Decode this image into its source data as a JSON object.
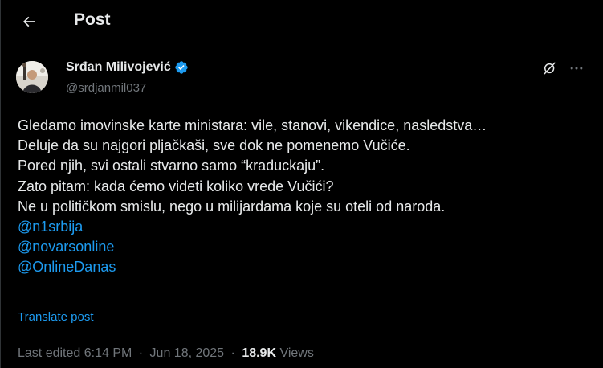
{
  "header": {
    "title": "Post",
    "back_icon": "arrow-left-icon"
  },
  "author": {
    "name": "Srđan Milivojević",
    "handle": "@srdjanmil037",
    "verified_color": "#1d9bf0",
    "verified_icon": "verified-badge-icon"
  },
  "actions": {
    "grok_icon": "grok-icon",
    "more_icon": "more-options-icon"
  },
  "tweet": {
    "lines": [
      "Gledamo imovinske karte ministara: vile, stanovi, vikendice, nasledstva…",
      "Deluje da su najgori pljačkaši, sve dok ne pomenemo Vučiće.",
      "Pored njih, svi ostali stvarno samo “kraduckaju”.",
      "Zato pitam: kada ćemo videti koliko vrede Vučići?",
      "Ne u političkom smislu, nego u milijardama koje su oteli od naroda."
    ],
    "mentions": [
      "@n1srbija",
      "@novarsonline",
      "@OnlineDanas"
    ],
    "mention_color": "#1d9bf0"
  },
  "translate_label": "Translate post",
  "meta": {
    "edited": "Last edited 6:14 PM",
    "date": "Jun 18, 2025",
    "separator": "·",
    "views_count": "18.9K",
    "views_label": "Views"
  }
}
